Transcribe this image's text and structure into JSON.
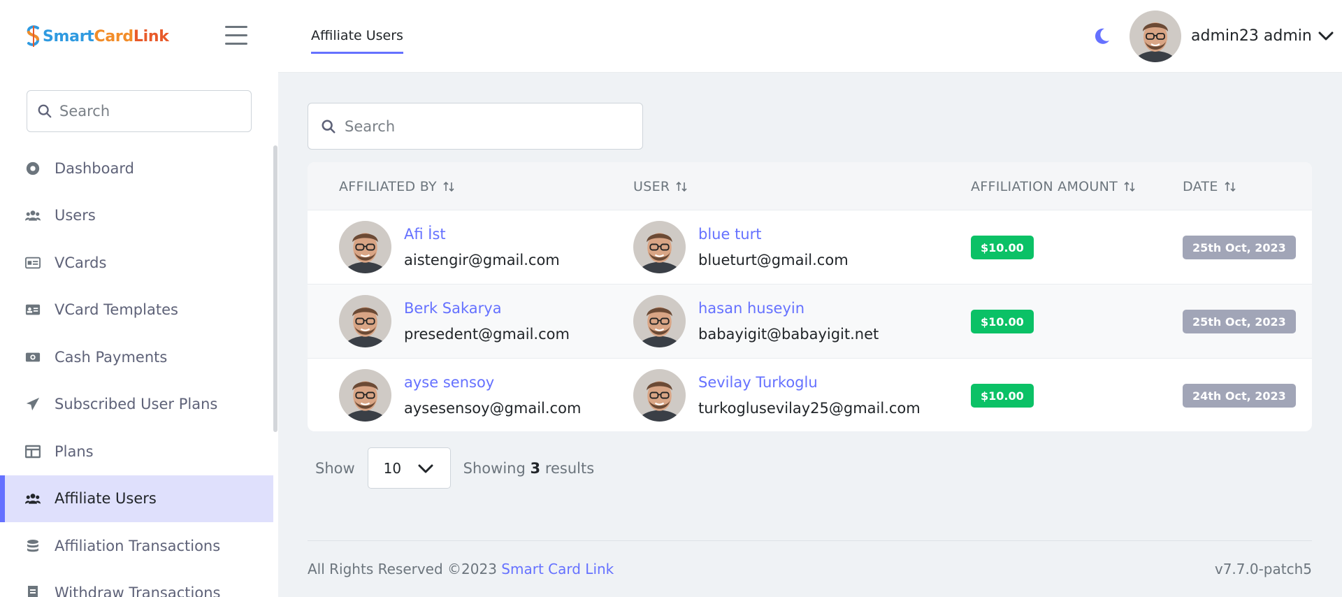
{
  "brand": {
    "part1": "Smart",
    "part2": "Card",
    "part3": "Link"
  },
  "header": {
    "tab_label": "Affiliate Users",
    "user_name": "admin23 admin"
  },
  "sidebar": {
    "search_placeholder": "Search",
    "items": [
      {
        "label": "Dashboard",
        "icon": "dashboard-icon"
      },
      {
        "label": "Users",
        "icon": "users-icon"
      },
      {
        "label": "VCards",
        "icon": "vcard-icon"
      },
      {
        "label": "VCard Templates",
        "icon": "vcard-template-icon"
      },
      {
        "label": "Cash Payments",
        "icon": "cash-icon"
      },
      {
        "label": "Subscribed User Plans",
        "icon": "paper-plane-icon"
      },
      {
        "label": "Plans",
        "icon": "plans-icon"
      },
      {
        "label": "Affiliate Users",
        "icon": "users-icon",
        "active": true
      },
      {
        "label": "Affiliation Transactions",
        "icon": "coins-icon"
      },
      {
        "label": "Withdraw Transactions",
        "icon": "receipt-icon"
      }
    ]
  },
  "main": {
    "search_placeholder": "Search",
    "columns": [
      "AFFILIATED BY",
      "USER",
      "AFFILIATION AMOUNT",
      "DATE"
    ],
    "rows": [
      {
        "affiliated_by": {
          "name": "Afi İst",
          "email": "aistengir@gmail.com"
        },
        "user": {
          "name": "blue turt",
          "email": "blueturt@gmail.com"
        },
        "amount": "$10.00",
        "date": "25th Oct, 2023"
      },
      {
        "affiliated_by": {
          "name": "Berk Sakarya",
          "email": "presedent@gmail.com"
        },
        "user": {
          "name": "hasan huseyin",
          "email": "babayigit@babayigit.net"
        },
        "amount": "$10.00",
        "date": "25th Oct, 2023"
      },
      {
        "affiliated_by": {
          "name": "ayse sensoy",
          "email": "aysesensoy@gmail.com"
        },
        "user": {
          "name": "Sevilay Turkoglu",
          "email": "turkoglusevilay25@gmail.com"
        },
        "amount": "$10.00",
        "date": "24th Oct, 2023"
      }
    ],
    "pager": {
      "show_label": "Show",
      "per_page": "10",
      "showing_prefix": "Showing",
      "showing_count": "3",
      "showing_suffix": "results"
    }
  },
  "footer": {
    "rights": "All Rights Reserved ©2023",
    "link": "Smart Card Link",
    "version": "v7.7.0-patch5"
  },
  "colors": {
    "accent": "#6571ff",
    "success": "#0bc166",
    "muted_badge": "#a1a5b7"
  }
}
